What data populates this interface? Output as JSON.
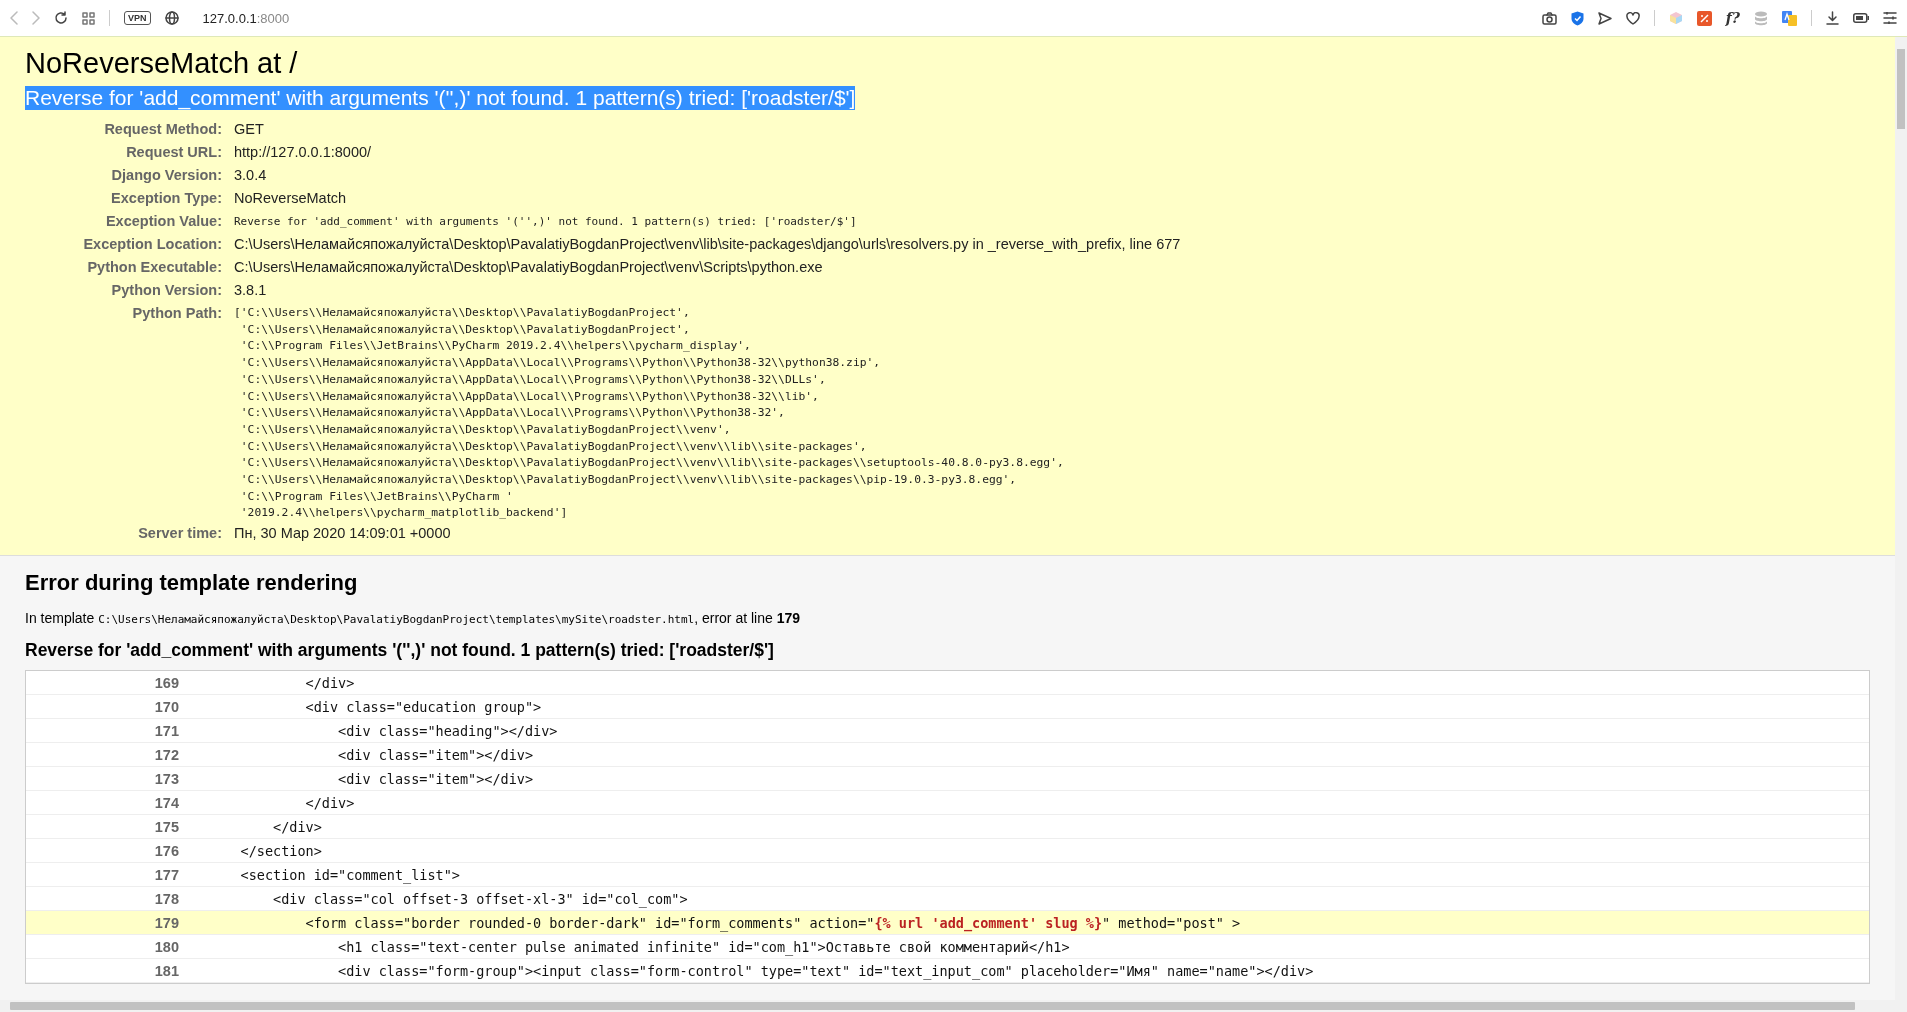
{
  "browser": {
    "vpn_label": "VPN",
    "url_host": "127.0.0.1",
    "url_port": ":8000",
    "extension_label": "f?"
  },
  "summary": {
    "title": "NoReverseMatch at /",
    "subtitle": "Reverse for 'add_comment' with arguments '('',)' not found. 1 pattern(s) tried: ['roadster/$']",
    "subtitle_selected": true,
    "meta": [
      {
        "label": "Request Method:",
        "kind": "text",
        "value": "GET"
      },
      {
        "label": "Request URL:",
        "kind": "text",
        "value": "http://127.0.0.1:8000/"
      },
      {
        "label": "Django Version:",
        "kind": "text",
        "value": "3.0.4"
      },
      {
        "label": "Exception Type:",
        "kind": "text",
        "value": "NoReverseMatch"
      },
      {
        "label": "Exception Value:",
        "kind": "code",
        "value": "Reverse for 'add_comment' with arguments '('',)' not found. 1 pattern(s) tried: ['roadster/$']"
      },
      {
        "label": "Exception Location:",
        "kind": "text",
        "value": "C:\\Users\\Неламайсяпожалуйста\\Desktop\\PavalatiyBogdanProject\\venv\\lib\\site-packages\\django\\urls\\resolvers.py in _reverse_with_prefix, line 677"
      },
      {
        "label": "Python Executable:",
        "kind": "text",
        "value": "C:\\Users\\Неламайсяпожалуйста\\Desktop\\PavalatiyBogdanProject\\venv\\Scripts\\python.exe"
      },
      {
        "label": "Python Version:",
        "kind": "text",
        "value": "3.8.1"
      },
      {
        "label": "Python Path:",
        "kind": "lines",
        "lines": [
          "['C:\\\\Users\\\\Неламайсяпожалуйста\\\\Desktop\\\\PavalatiyBogdanProject',",
          " 'C:\\\\Users\\\\Неламайсяпожалуйста\\\\Desktop\\\\PavalatiyBogdanProject',",
          " 'C:\\\\Program Files\\\\JetBrains\\\\PyCharm 2019.2.4\\\\helpers\\\\pycharm_display',",
          " 'C:\\\\Users\\\\Неламайсяпожалуйста\\\\AppData\\\\Local\\\\Programs\\\\Python\\\\Python38-32\\\\python38.zip',",
          " 'C:\\\\Users\\\\Неламайсяпожалуйста\\\\AppData\\\\Local\\\\Programs\\\\Python\\\\Python38-32\\\\DLLs',",
          " 'C:\\\\Users\\\\Неламайсяпожалуйста\\\\AppData\\\\Local\\\\Programs\\\\Python\\\\Python38-32\\\\lib',",
          " 'C:\\\\Users\\\\Неламайсяпожалуйста\\\\AppData\\\\Local\\\\Programs\\\\Python\\\\Python38-32',",
          " 'C:\\\\Users\\\\Неламайсяпожалуйста\\\\Desktop\\\\PavalatiyBogdanProject\\\\venv',",
          " 'C:\\\\Users\\\\Неламайсяпожалуйста\\\\Desktop\\\\PavalatiyBogdanProject\\\\venv\\\\lib\\\\site-packages',",
          " 'C:\\\\Users\\\\Неламайсяпожалуйста\\\\Desktop\\\\PavalatiyBogdanProject\\\\venv\\\\lib\\\\site-packages\\\\setuptools-40.8.0-py3.8.egg',",
          " 'C:\\\\Users\\\\Неламайсяпожалуйста\\\\Desktop\\\\PavalatiyBogdanProject\\\\venv\\\\lib\\\\site-packages\\\\pip-19.0.3-py3.8.egg',",
          " 'C:\\\\Program Files\\\\JetBrains\\\\PyCharm '",
          " '2019.2.4\\\\helpers\\\\pycharm_matplotlib_backend']"
        ]
      },
      {
        "label": "Server time:",
        "kind": "text",
        "value": "Пн, 30 Мар 2020 14:09:01 +0000"
      }
    ]
  },
  "template": {
    "heading": "Error during template rendering",
    "info": {
      "prefix": "In template ",
      "path": "C:\\Users\\Неламайсяпожалуйста\\Desktop\\PavalatiyBogdanProject\\templates\\mySite\\roadster.html",
      "suffix": ", error at line ",
      "line": "179"
    },
    "error": "Reverse for 'add_comment' with arguments '('',)' not found. 1 pattern(s) tried: ['roadster/$']",
    "lines": [
      {
        "number": "169",
        "code": "            </div>",
        "highlighted": false
      },
      {
        "number": "170",
        "code": "            <div class=\"education group\">",
        "highlighted": false
      },
      {
        "number": "171",
        "code": "                <div class=\"heading\"></div>",
        "highlighted": false
      },
      {
        "number": "172",
        "code": "                <div class=\"item\"></div>",
        "highlighted": false
      },
      {
        "number": "173",
        "code": "                <div class=\"item\"></div>",
        "highlighted": false
      },
      {
        "number": "174",
        "code": "            </div>",
        "highlighted": false
      },
      {
        "number": "175",
        "code": "        </div>",
        "highlighted": false
      },
      {
        "number": "176",
        "code": "    </section>",
        "highlighted": false
      },
      {
        "number": "177",
        "code": "    <section id=\"comment_list\">",
        "highlighted": false
      },
      {
        "number": "178",
        "code": "        <div class=\"col offset-3 offset-xl-3\" id=\"col_com\">",
        "highlighted": false
      },
      {
        "number": "179",
        "code": "            <form class=\"border rounded-0 border-dark\" id=\"form_comments\" action=\"**{% url 'add_comment' slug %}**\" method=\"post\" >",
        "highlighted": true
      },
      {
        "number": "180",
        "code": "                <h1 class=\"text-center pulse animated infinite\" id=\"com_h1\">Оставьте свой комментарий</h1>",
        "highlighted": false
      },
      {
        "number": "181",
        "code": "                <div class=\"form-group\"><input class=\"form-control\" type=\"text\" id=\"text_input_com\" placeholder=\"Имя\" name=\"name\"></div>",
        "highlighted": false
      }
    ]
  }
}
